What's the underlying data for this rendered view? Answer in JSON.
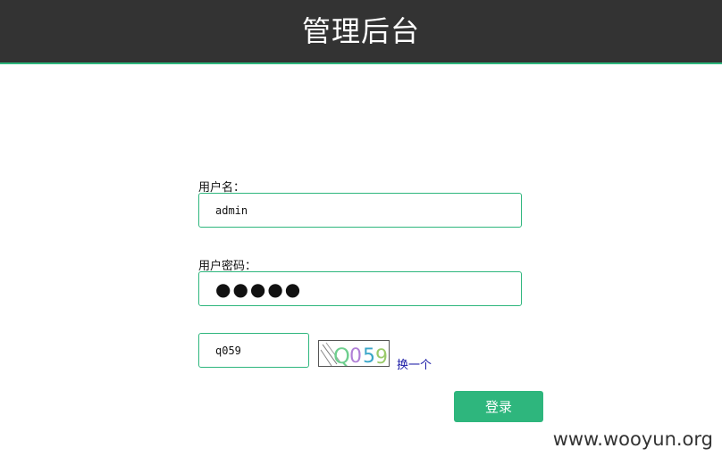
{
  "header": {
    "title": "管理后台"
  },
  "form": {
    "username_label": "用户名：",
    "username_value": "admin",
    "password_label": "用户密码：",
    "password_value": "●●●●●",
    "captcha_value": "q059",
    "captcha_image_text": "Q059",
    "refresh_label": "换一个",
    "login_label": "登录"
  },
  "watermark": "www.wooyun.org",
  "colors": {
    "header_bg": "#333333",
    "accent": "#2eb67d",
    "link": "#1a1aa6"
  }
}
